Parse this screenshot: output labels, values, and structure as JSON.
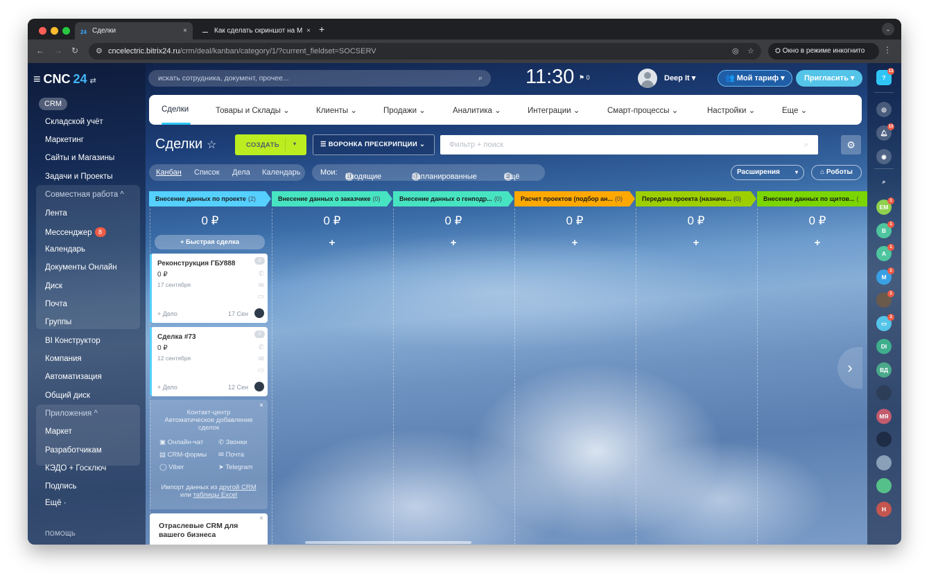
{
  "browser": {
    "tabs": [
      {
        "title": "Сделки",
        "icon": "24",
        "close": "×"
      },
      {
        "title": "Как сделать скриншот на М",
        "icon": "",
        "close": "×"
      }
    ],
    "new_tab": "+",
    "url_host": "cncelectric.bitrix24.ru",
    "url_path": "/crm/deal/kanban/category/1/?current_fieldset=SOCSERV",
    "incognito_label": "Окно в режиме инкогнито"
  },
  "leftnav": {
    "logo": "CNC",
    "logo_num": "24",
    "logo_switch": "⇄",
    "crm": "CRM",
    "items": [
      {
        "label": "Складской учёт"
      },
      {
        "label": "Маркетинг"
      },
      {
        "label": "Сайты и Магазины"
      },
      {
        "label": "Задачи и Проекты"
      },
      {
        "label": "Совместная работа ^"
      },
      {
        "label": "Лента"
      },
      {
        "label": "Мессенджер",
        "badge": "8"
      },
      {
        "label": "Календарь"
      },
      {
        "label": "Документы Онлайн"
      },
      {
        "label": "Диск"
      },
      {
        "label": "Почта"
      },
      {
        "label": "Группы"
      },
      {
        "label": "BI Конструктор"
      },
      {
        "label": "Компания"
      },
      {
        "label": "Автоматизация"
      },
      {
        "label": "Общий диск"
      },
      {
        "label": "Приложения ^"
      },
      {
        "label": "Маркет"
      },
      {
        "label": "Разработчикам"
      },
      {
        "label": "КЭДО + Госключ"
      },
      {
        "label": "Подпись"
      },
      {
        "label": "Ещё ·"
      }
    ],
    "help": "ПОМОЩЬ"
  },
  "header": {
    "search_placeholder": "искать сотрудника, документ, прочее...",
    "time": "11:30",
    "flag_count": "0",
    "user_name": "Deep It",
    "tariff": "Мой тариф",
    "invite": "Пригласить"
  },
  "topmenu": [
    "Сделки",
    "Товары и Склады",
    "Клиенты",
    "Продажи",
    "Аналитика",
    "Интеграции",
    "Смарт-процессы",
    "Настройки",
    "Еще"
  ],
  "toolbar": {
    "title": "Сделки",
    "create": "СОЗДАТЬ",
    "funnel": "ВОРОНКА ПРЕСКРИПЦИИ",
    "filter_placeholder": "Фильтр + поиск"
  },
  "views": {
    "items": [
      "Канбан",
      "Список",
      "Дела",
      "Календарь"
    ],
    "mine_label": "Мои:",
    "incoming_count": "0",
    "incoming": "Входящие",
    "planned_count": "0",
    "planned": "Запланированные",
    "more_count": "0",
    "more": "Ещё",
    "extensions": "Расширения",
    "robots": "Роботы"
  },
  "stages": [
    {
      "name": "Внесение данных по проекте",
      "count": "(2)",
      "color": "#55d0ff",
      "sum": "0 ₽"
    },
    {
      "name": "Внесение данных о заказчике",
      "count": "(0)",
      "color": "#47e4c2",
      "sum": "0 ₽"
    },
    {
      "name": "Внесение данных о генподр...",
      "count": "(0)",
      "color": "#47e4c2",
      "sum": "0 ₽"
    },
    {
      "name": "Расчет проектов (подбор ан...",
      "count": "(0)",
      "color": "#ffa900",
      "sum": "0 ₽"
    },
    {
      "name": "Передача проекта (назначе...",
      "count": "(0)",
      "color": "#9dcf00",
      "sum": "0 ₽"
    },
    {
      "name": "Внесение данных по щитов...",
      "count": "(",
      "color": "#7bd500",
      "sum": "0 ₽"
    }
  ],
  "quick_deal": "+ Быстрая сделка",
  "add_symbol": "+",
  "cards": [
    {
      "title": "Реконструкция ГБУ888",
      "counter": "0",
      "sum": "0 ₽",
      "date": "17 сентября",
      "add": "+ Дело",
      "short_date": "17 Сен"
    },
    {
      "title": "Сделка #73",
      "counter": "0",
      "sum": "0 ₽",
      "date": "12 сентября",
      "add": "+ Дело",
      "short_date": "12 Сен"
    }
  ],
  "contact_center": {
    "close": "×",
    "title_1": "Контакт-центр",
    "title_2": "Автоматическое добавление",
    "title_3": "сделок",
    "chat": "Онлайн-чат",
    "calls": "Звонки",
    "forms": "CRM-формы",
    "mail": "Почта",
    "viber": "Viber",
    "telegram": "Telegram",
    "import_1": "Импорт данных из ",
    "import_link1": "другой CRM",
    "import_2": "или ",
    "import_link2": "таблицы Excel"
  },
  "industry": {
    "title_1": "Отраслевые CRM для",
    "title_2": "вашего бизнеса",
    "close": "×"
  },
  "next_arrow": "›",
  "rightbar": {
    "help_badge": "13",
    "bell_badge": "13",
    "avatars": [
      {
        "initials": "ЕМ",
        "color": "#8fd14f",
        "badge": "1"
      },
      {
        "initials": "В",
        "color": "#4ec59f",
        "badge": "1"
      },
      {
        "initials": "А",
        "color": "#4ec59f",
        "badge": "1"
      },
      {
        "initials": "М",
        "color": "#3aa0e4",
        "badge": "1"
      },
      {
        "initials": "",
        "color": "#6a5a4c",
        "badge": "1"
      },
      {
        "initials": "",
        "color": "#55c4e9",
        "badge": "3"
      },
      {
        "initials": "DI",
        "color": "#3fae8c",
        "badge": ""
      },
      {
        "initials": "ВД",
        "color": "#4aa88a",
        "badge": ""
      },
      {
        "initials": "",
        "color": "#2d3e58",
        "badge": ""
      },
      {
        "initials": "МЯ",
        "color": "#c45b6e",
        "badge": ""
      },
      {
        "initials": "",
        "color": "#1e2c46",
        "badge": ""
      },
      {
        "initials": "",
        "color": "#8aa0b8",
        "badge": ""
      },
      {
        "initials": "",
        "color": "#56c08a",
        "badge": ""
      },
      {
        "initials": "Н",
        "color": "#c4564f",
        "badge": ""
      }
    ]
  }
}
